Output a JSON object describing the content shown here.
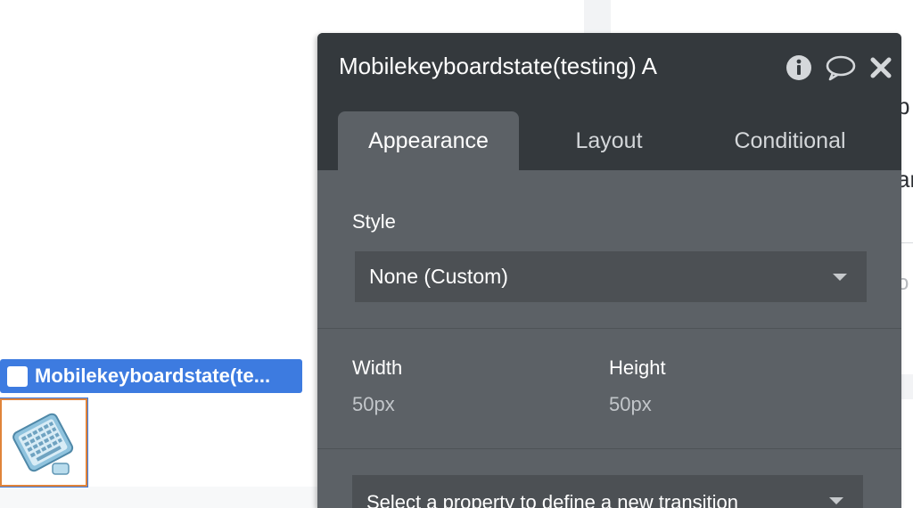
{
  "canvas": {
    "right_fragments": [
      "b",
      "ar",
      "o"
    ]
  },
  "element": {
    "label": "Mobilekeyboardstate(te...",
    "thumbnail_icon": "keyboard-icon"
  },
  "panel": {
    "title": "Mobilekeyboardstate(testing) A",
    "icons": [
      "info-icon",
      "comment-icon",
      "close-icon"
    ],
    "tabs": [
      {
        "label": "Appearance",
        "active": true
      },
      {
        "label": "Layout",
        "active": false
      },
      {
        "label": "Conditional",
        "active": false
      }
    ],
    "style": {
      "label": "Style",
      "value": "None (Custom)"
    },
    "size": {
      "width_label": "Width",
      "width_value": "50px",
      "height_label": "Height",
      "height_value": "50px"
    },
    "transition": {
      "placeholder": "Select a property to define a new transition"
    }
  },
  "colors": {
    "accent_blue": "#3d7be0",
    "selection_orange": "#e0843a",
    "panel_bg": "#5c6166",
    "panel_header": "#34393d"
  }
}
